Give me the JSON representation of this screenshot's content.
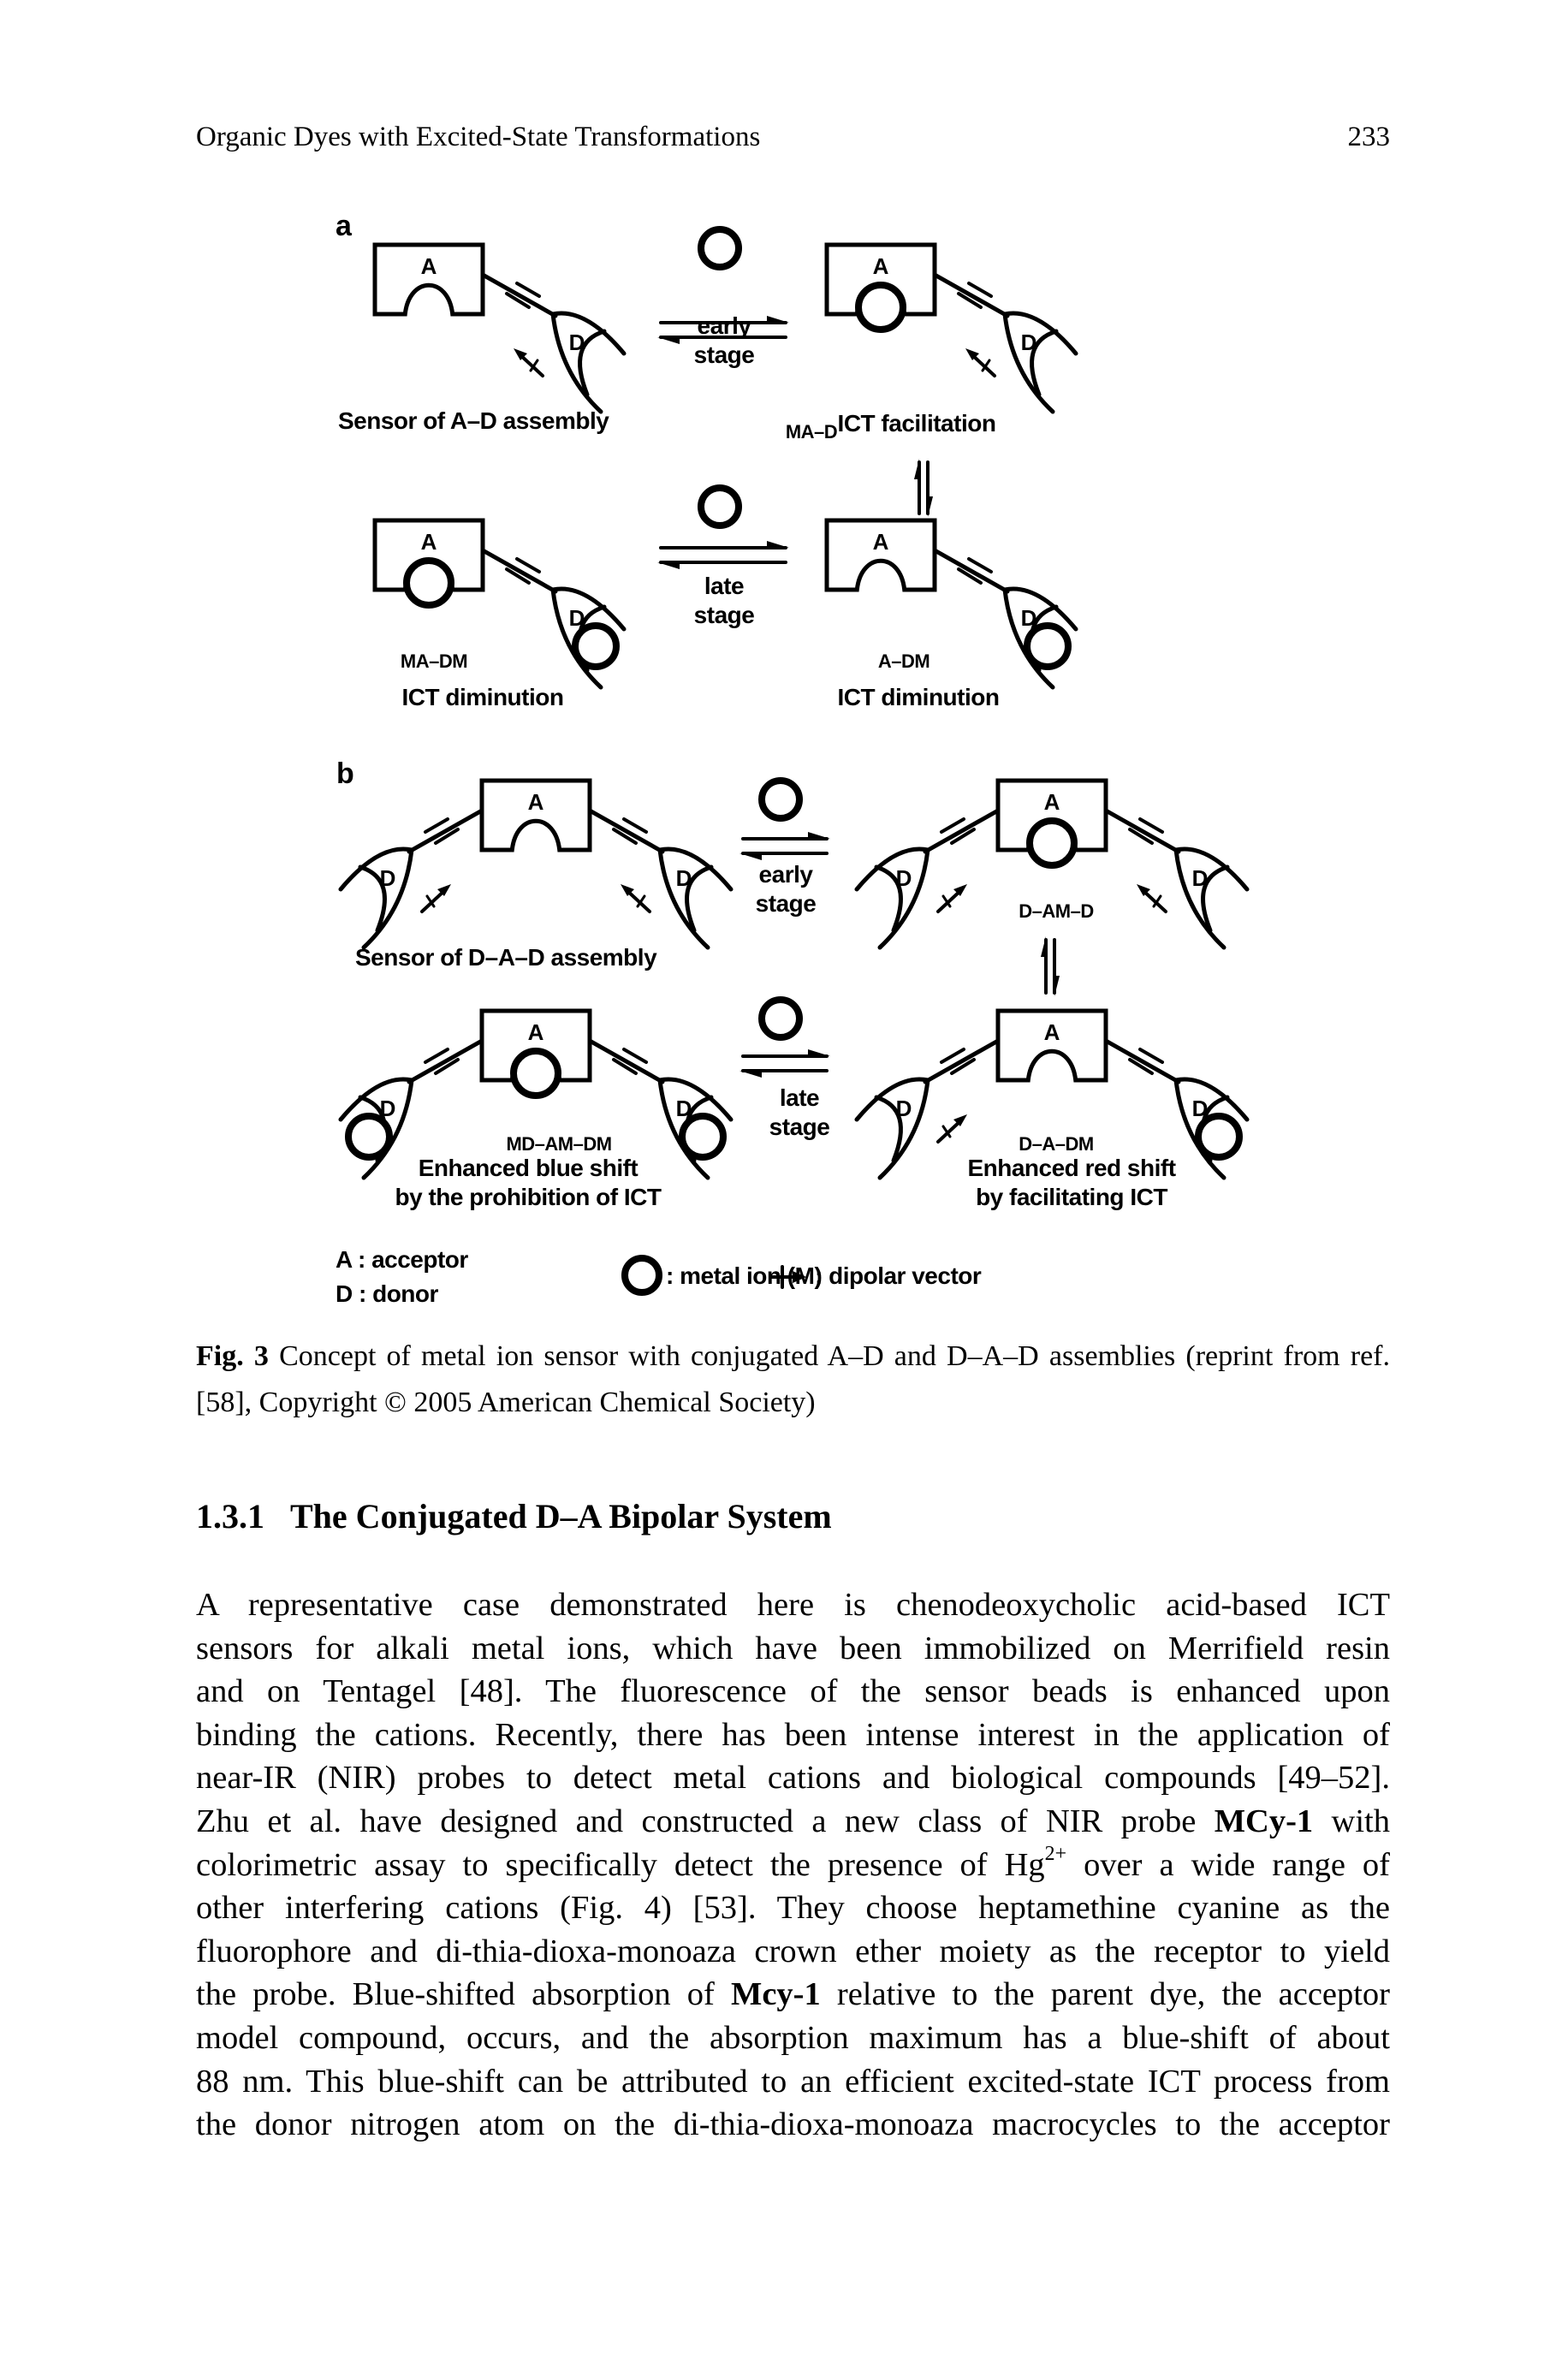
{
  "header": {
    "running_title": "Organic Dyes with Excited-State Transformations",
    "page_number": "233"
  },
  "figure": {
    "panel_a": {
      "label": "a",
      "early_stage": [
        "early",
        "stage"
      ],
      "late_stage": [
        "late",
        "stage"
      ],
      "sensor_label": "Sensor of A–D assembly",
      "ma_d": "MA–D",
      "ict_facilitation": "ICT facilitation",
      "ma_dm": "MA–DM",
      "ict_diminution_left": "ICT diminution",
      "a_dm": "A–DM",
      "ict_diminution_right": "ICT diminution",
      "acceptor_letter": "A",
      "donor_letter": "D"
    },
    "panel_b": {
      "label": "b",
      "early_stage": [
        "early",
        "stage"
      ],
      "late_stage": [
        "late",
        "stage"
      ],
      "sensor_label": "Sensor of D–A–D assembly",
      "d_am_d": "D–AM–D",
      "md_am_dm": "MD–AM–DM",
      "blue_shift": [
        "Enhanced blue shift",
        "by the prohibition of ICT"
      ],
      "d_a_dm": "D–A–DM",
      "red_shift": [
        "Enhanced red shift",
        "by facilitating ICT"
      ]
    },
    "legend": {
      "acceptor": "A : acceptor",
      "donor": "D : donor",
      "metal_ion": ": metal ion (M)",
      "dipolar_vector": ": dipolar vector"
    }
  },
  "caption": {
    "label": "Fig. 3",
    "line1": "Concept of metal ion sensor with conjugated A–D and D–A–D assemblies (reprint from ref.",
    "line2": "[58], Copyright © 2005 American Chemical Society)"
  },
  "section": {
    "number": "1.3.1",
    "title": "The Conjugated D–A Bipolar System"
  },
  "body_lines": [
    [
      {
        "t": "A representative case demonstrated here is chenodeoxycholic acid-based ICT"
      }
    ],
    [
      {
        "t": "sensors for alkali metal ions, which have been immobilized on Merrifield resin"
      }
    ],
    [
      {
        "t": "and on Tentagel [48]. The fluorescence of the sensor beads is enhanced upon"
      }
    ],
    [
      {
        "t": "binding the cations. Recently, there has been intense interest in the application of"
      }
    ],
    [
      {
        "t": "near-IR (NIR) probes to detect metal cations and biological compounds [49–52]."
      }
    ],
    [
      {
        "t": "Zhu et al. have designed and constructed a new class of NIR probe "
      },
      {
        "t": "MCy-1",
        "b": true
      },
      {
        "t": " with"
      }
    ],
    [
      {
        "t": "colorimetric assay to specifically detect the presence of Hg"
      },
      {
        "t": "2+",
        "sup": true
      },
      {
        "t": " over a wide range of"
      }
    ],
    [
      {
        "t": "other interfering cations (Fig. 4) [53]. They choose heptamethine cyanine as the"
      }
    ],
    [
      {
        "t": "fluorophore and di-thia-dioxa-monoaza crown ether moiety as the receptor to yield"
      }
    ],
    [
      {
        "t": "the probe. Blue-shifted absorption of "
      },
      {
        "t": "Mcy-1",
        "b": true
      },
      {
        "t": " relative to the parent dye, the acceptor"
      }
    ],
    [
      {
        "t": "model compound, occurs, and the absorption maximum has a blue-shift of about"
      }
    ],
    [
      {
        "t": "88 nm. This blue-shift can be attributed to an efficient excited-state ICT process from"
      }
    ],
    [
      {
        "t": "the donor nitrogen atom on the di-thia-dioxa-monoaza macrocycles to the acceptor"
      }
    ]
  ]
}
